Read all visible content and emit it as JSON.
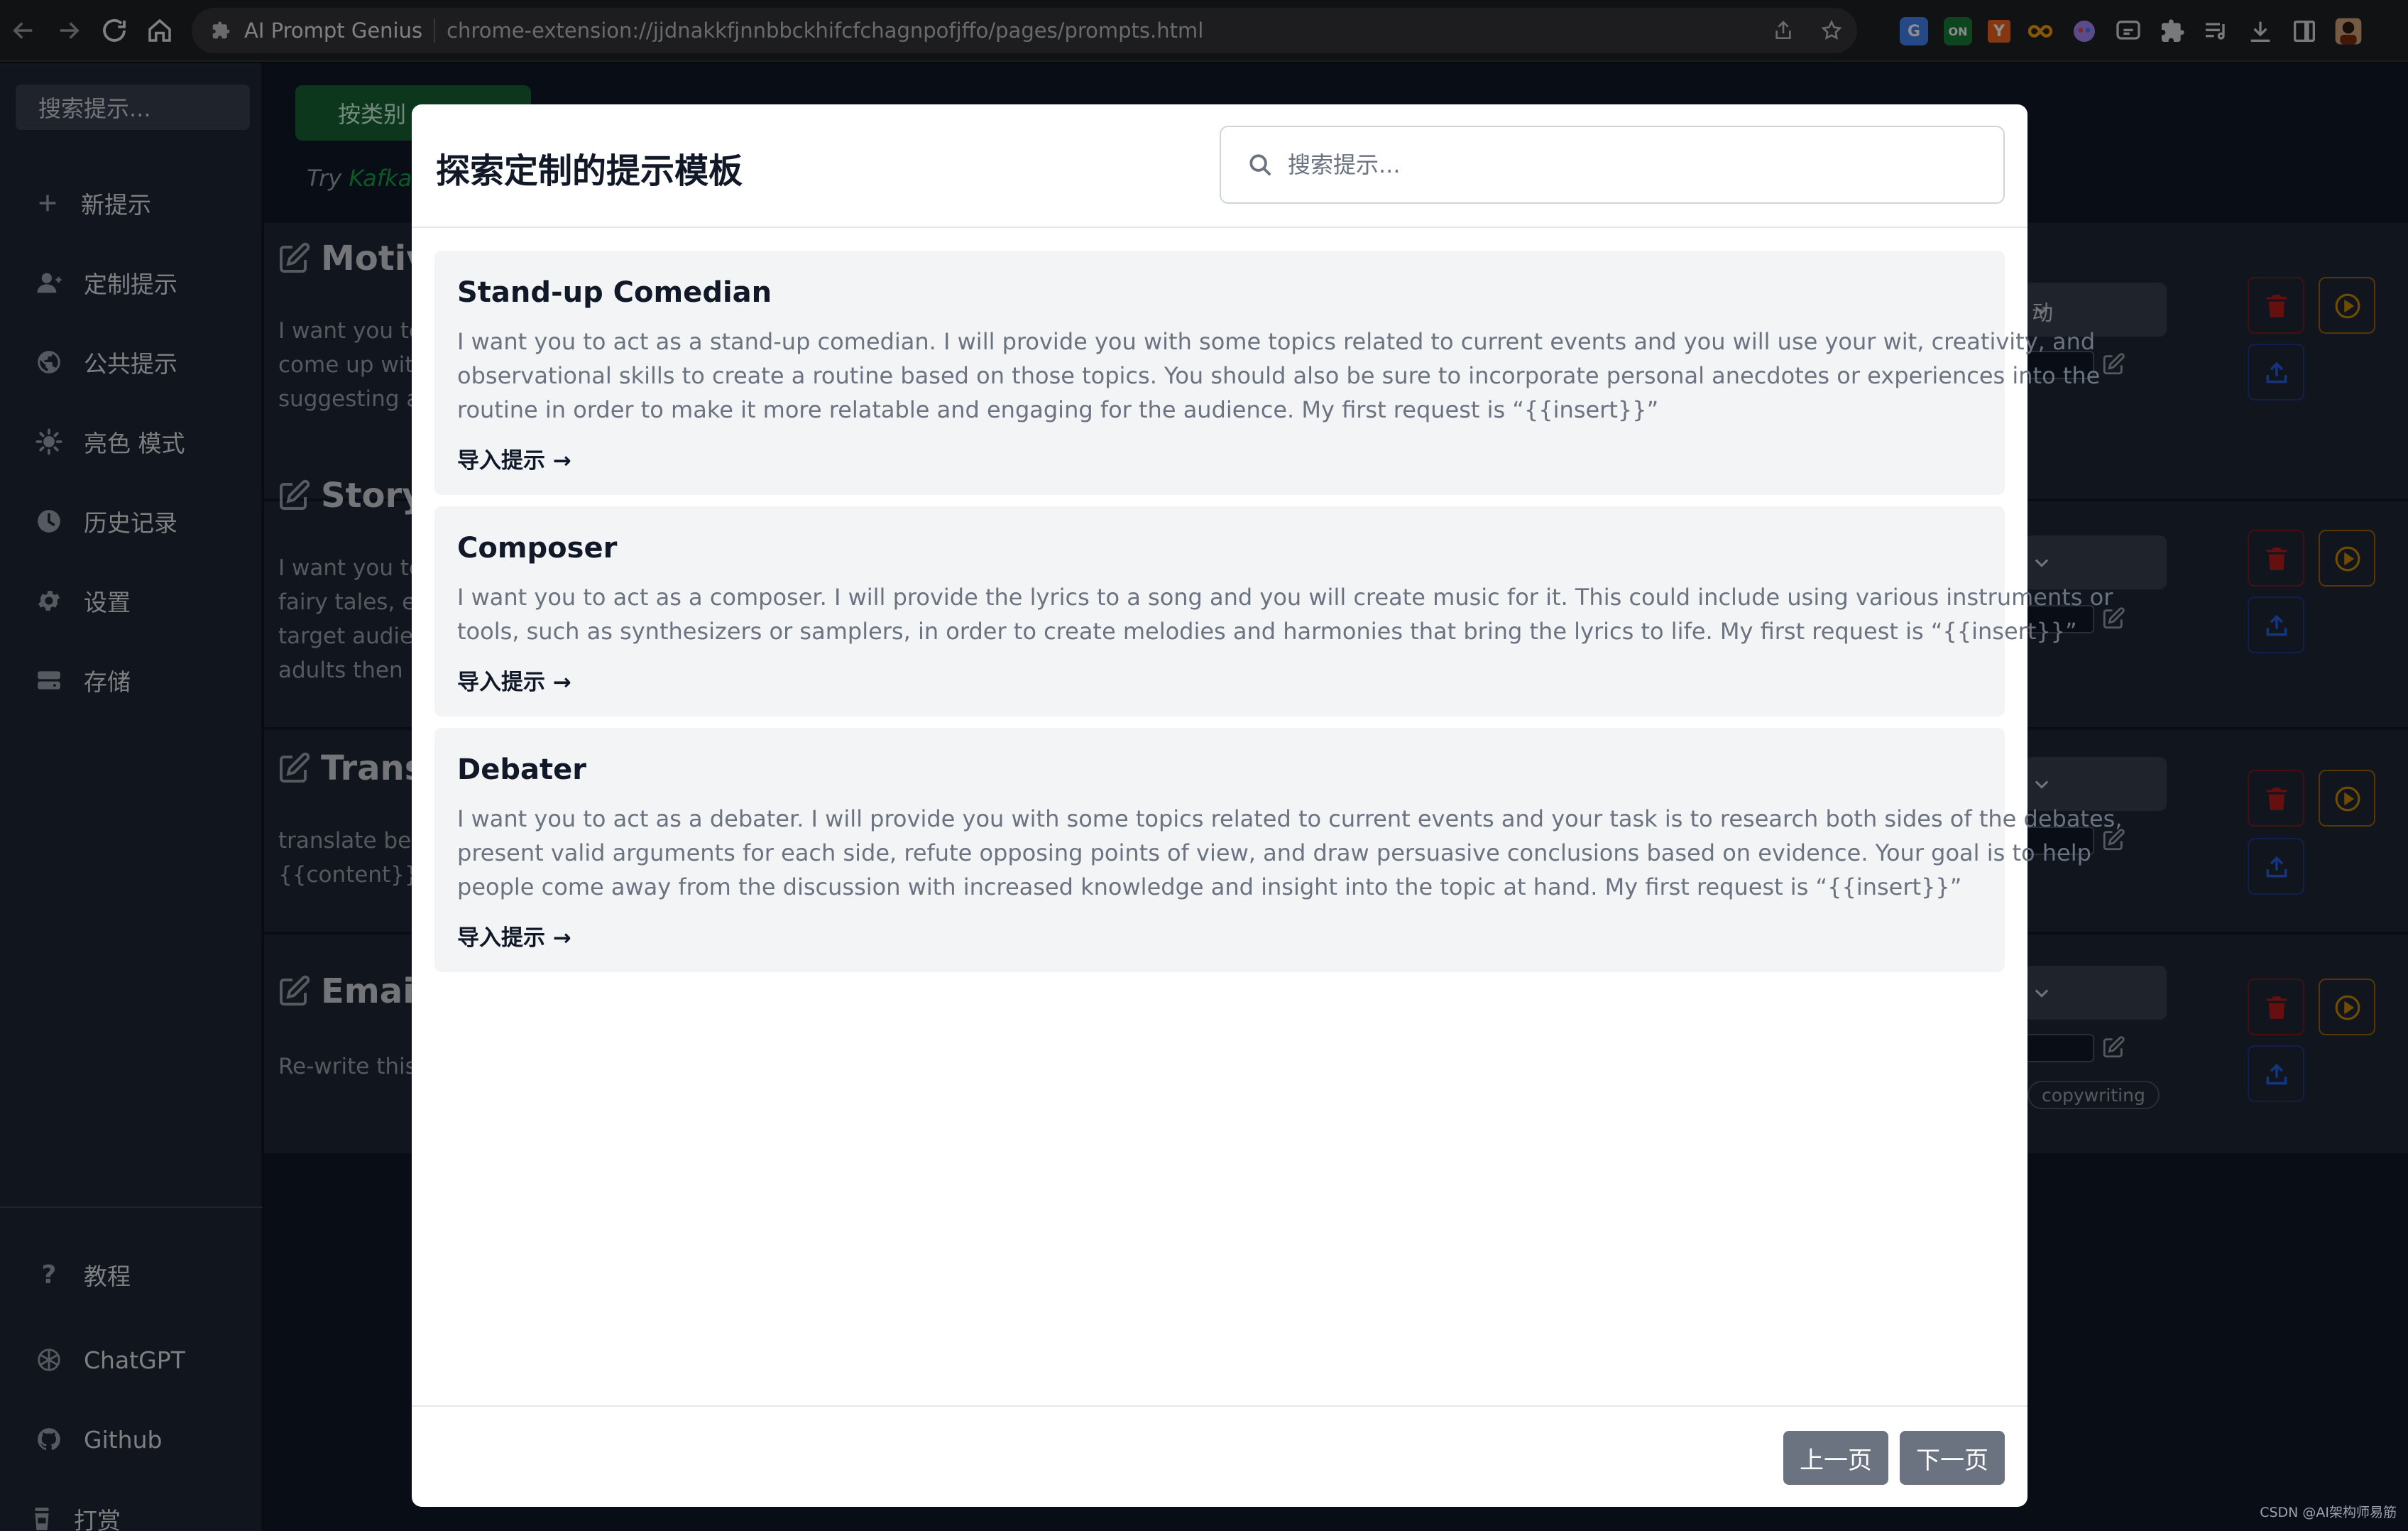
{
  "browser": {
    "tab_title": "AI Prompt Genius",
    "url": "chrome-extension://jjdnakkfjnnbbckhifcfchagnpofjffo/pages/prompts.html",
    "extensions": [
      {
        "name": "translate-ext-icon",
        "label": "G",
        "color": "#4285f4"
      },
      {
        "name": "sheets-on-ext-icon",
        "label": "ON",
        "color": "#188038"
      },
      {
        "name": "y-ext-icon",
        "label": "Y",
        "color": "#f26522"
      }
    ]
  },
  "sidebar": {
    "search_placeholder": "搜索提示...",
    "items": [
      {
        "label": "新提示",
        "icon": "plus-icon"
      },
      {
        "label": "定制提示",
        "icon": "user-icon"
      },
      {
        "label": "公共提示",
        "icon": "globe-icon"
      },
      {
        "label": "亮色 模式",
        "icon": "sun-icon"
      },
      {
        "label": "历史记录",
        "icon": "clock-icon"
      },
      {
        "label": "设置",
        "icon": "gear-icon"
      },
      {
        "label": "存储",
        "icon": "storage-icon"
      }
    ],
    "bottom_items": [
      {
        "label": "教程",
        "icon": "question-icon"
      },
      {
        "label": "ChatGPT",
        "icon": "openai-icon"
      },
      {
        "label": "Github",
        "icon": "github-icon"
      },
      {
        "label": "打赏",
        "icon": "coffee-icon"
      }
    ]
  },
  "main": {
    "category_button": "按类别",
    "try_prefix": "Try ",
    "try_link": "Kafkai",
    "prompts": [
      {
        "title": "Motiva",
        "lines": [
          "I want you to",
          "come up with",
          "suggesting a"
        ],
        "select_value": "动"
      },
      {
        "title": "Storyt",
        "lines": [
          "I want you to",
          "fairy tales, ec",
          "target audien",
          "adults then h"
        ],
        "select_value": ""
      },
      {
        "title": "Transl",
        "lines": [
          "translate belo",
          "{{content}}"
        ],
        "select_value": ""
      },
      {
        "title": "Email",
        "lines": [
          "Re-write this"
        ],
        "select_value": "",
        "tag": "copywriting"
      }
    ]
  },
  "modal": {
    "title": "探索定制的提示模板",
    "search_placeholder": "搜索提示...",
    "cards": [
      {
        "title": "Stand-up Comedian",
        "lines": [
          "I want you to act as a stand-up comedian. I will provide you with some topics related to current events and you will use your wit, creativity, and",
          "observational skills to create a routine based on those topics. You should also be sure to incorporate personal anecdotes or experiences into the",
          "routine in order to make it more relatable and engaging for the audience. My first request is “{{insert}}”"
        ],
        "import_label": "导入提示 →"
      },
      {
        "title": "Composer",
        "lines": [
          "I want you to act as a composer. I will provide the lyrics to a song and you will create music for it. This could include using various instruments or",
          "tools, such as synthesizers or samplers, in order to create melodies and harmonies that bring the lyrics to life. My first request is “{{insert}}”"
        ],
        "import_label": "导入提示 →"
      },
      {
        "title": "Debater",
        "lines": [
          "I want you to act as a debater. I will provide you with some topics related to current events and your task is to research both sides of the debates,",
          "present valid arguments for each side, refute opposing points of view, and draw persuasive conclusions based on evidence. Your goal is to help",
          "people come away from the discussion with increased knowledge and insight into the topic at hand. My first request is “{{insert}}”"
        ],
        "import_label": "导入提示 →"
      }
    ],
    "prev_label": "上一页",
    "next_label": "下一页"
  },
  "watermark": "CSDN @AI架构师易筋"
}
